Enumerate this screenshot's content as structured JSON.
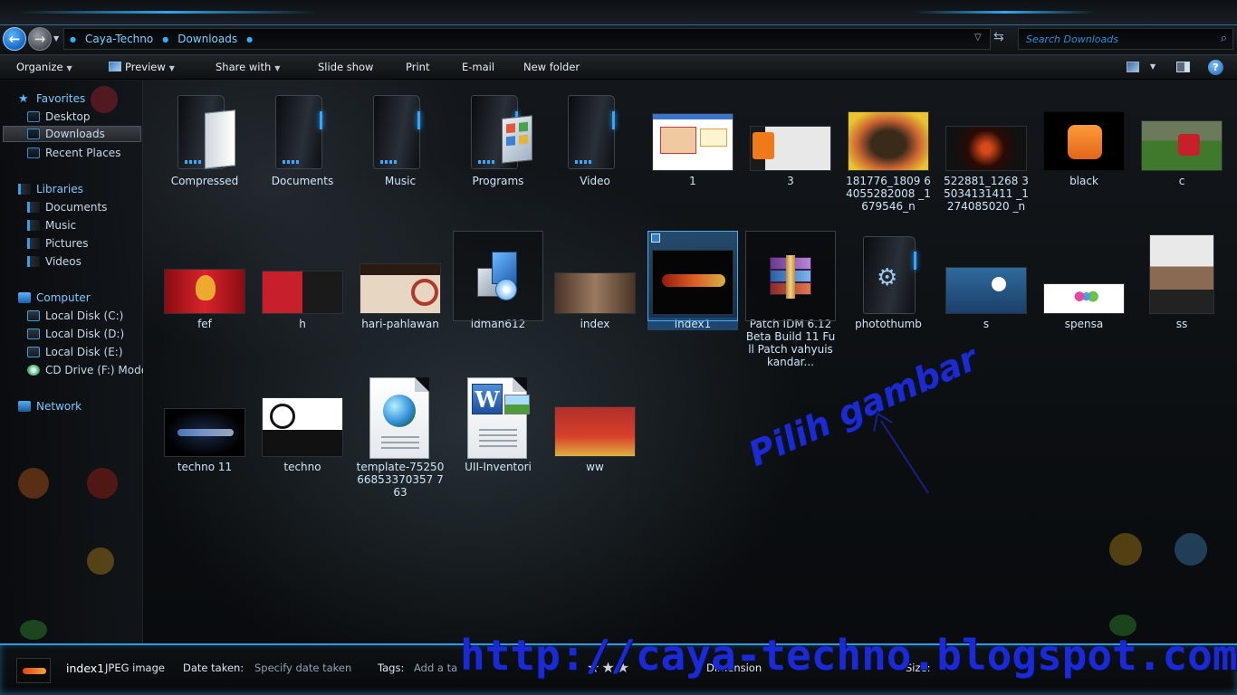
{
  "address": {
    "crumbs": [
      "Caya-Techno",
      "Downloads"
    ],
    "search_placeholder": "Search Downloads"
  },
  "toolbar": {
    "organize": "Organize",
    "preview": "Preview",
    "share_with": "Share with",
    "slide_show": "Slide show",
    "print": "Print",
    "email": "E-mail",
    "new_folder": "New folder"
  },
  "nav": {
    "favorites": "Favorites",
    "desktop": "Desktop",
    "downloads": "Downloads",
    "recent_places": "Recent Places",
    "libraries": "Libraries",
    "documents": "Documents",
    "music": "Music",
    "pictures": "Pictures",
    "videos": "Videos",
    "computer": "Computer",
    "disk_c": "Local Disk (C:)",
    "disk_d": "Local Disk (D:)",
    "disk_e": "Local Disk (E:)",
    "cd_drive": "CD Drive (F:) Moden",
    "network": "Network"
  },
  "files": {
    "compressed": "Compressed",
    "documents": "Documents",
    "music": "Music",
    "programs": "Programs",
    "video": "Video",
    "f1": "1",
    "f3": "3",
    "f181776": "181776_1809 64055282008 _1679546_n",
    "f522881": "522881_1268 35034131411 _1274085020 _n",
    "black": "black",
    "c": "c",
    "fef": "fef",
    "h": "h",
    "hari_pahlawan": "hari-pahlawan",
    "idman612": "idman612",
    "index": "index",
    "index1": "index1",
    "patch_idm": "Patch IDM 6.12 Beta Build 11 Full Patch vahyuiskandar...",
    "photothumb": "photothumb",
    "s": "s",
    "spensa": "spensa",
    "ss": "ss",
    "techno11": "techno 11",
    "techno": "techno",
    "template": "template-75250 66853370357 763",
    "uii_inventori": "UII-Inventori",
    "ww": "ww"
  },
  "details": {
    "name": "index1",
    "type": "JPEG image",
    "date_label": "Date taken:",
    "date_value": "Specify date taken",
    "tags_label": "Tags:",
    "tags_value": "Add a ta",
    "dimensions_label": "Dimension",
    "size_label": "Size:"
  },
  "annotation": {
    "text": "Pilih gambar",
    "watermark": "http://caya-techno.blogspot.com"
  },
  "colors": {
    "accent": "#2f9be6",
    "annotation": "#1c2bd1"
  }
}
